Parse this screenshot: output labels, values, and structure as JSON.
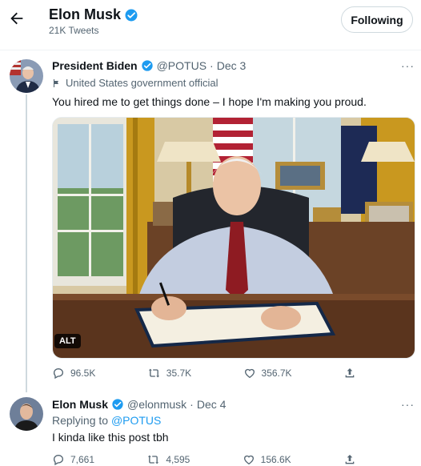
{
  "header": {
    "title": "Elon Musk",
    "tweet_count": "21K Tweets",
    "follow_label": "Following"
  },
  "tweet1": {
    "author": "President Biden",
    "handle": "@POTUS",
    "separator": "·",
    "date": "Dec 3",
    "more": "···",
    "label": "United States government official",
    "text": "You hired me to get things done – I hope I'm making you proud.",
    "alt_badge": "ALT",
    "replies": "96.5K",
    "retweets": "35.7K",
    "likes": "356.7K"
  },
  "tweet2": {
    "author": "Elon Musk",
    "handle": "@elonmusk",
    "separator": "·",
    "date": "Dec 4",
    "more": "···",
    "replying_prefix": "Replying to",
    "replying_handle": "@POTUS",
    "text": "I kinda like this post tbh",
    "replies": "7,661",
    "retweets": "4,595",
    "likes": "156.6K"
  },
  "colors": {
    "verified": "#1d9bf0",
    "text_primary": "#0f1419",
    "text_secondary": "#536471"
  }
}
